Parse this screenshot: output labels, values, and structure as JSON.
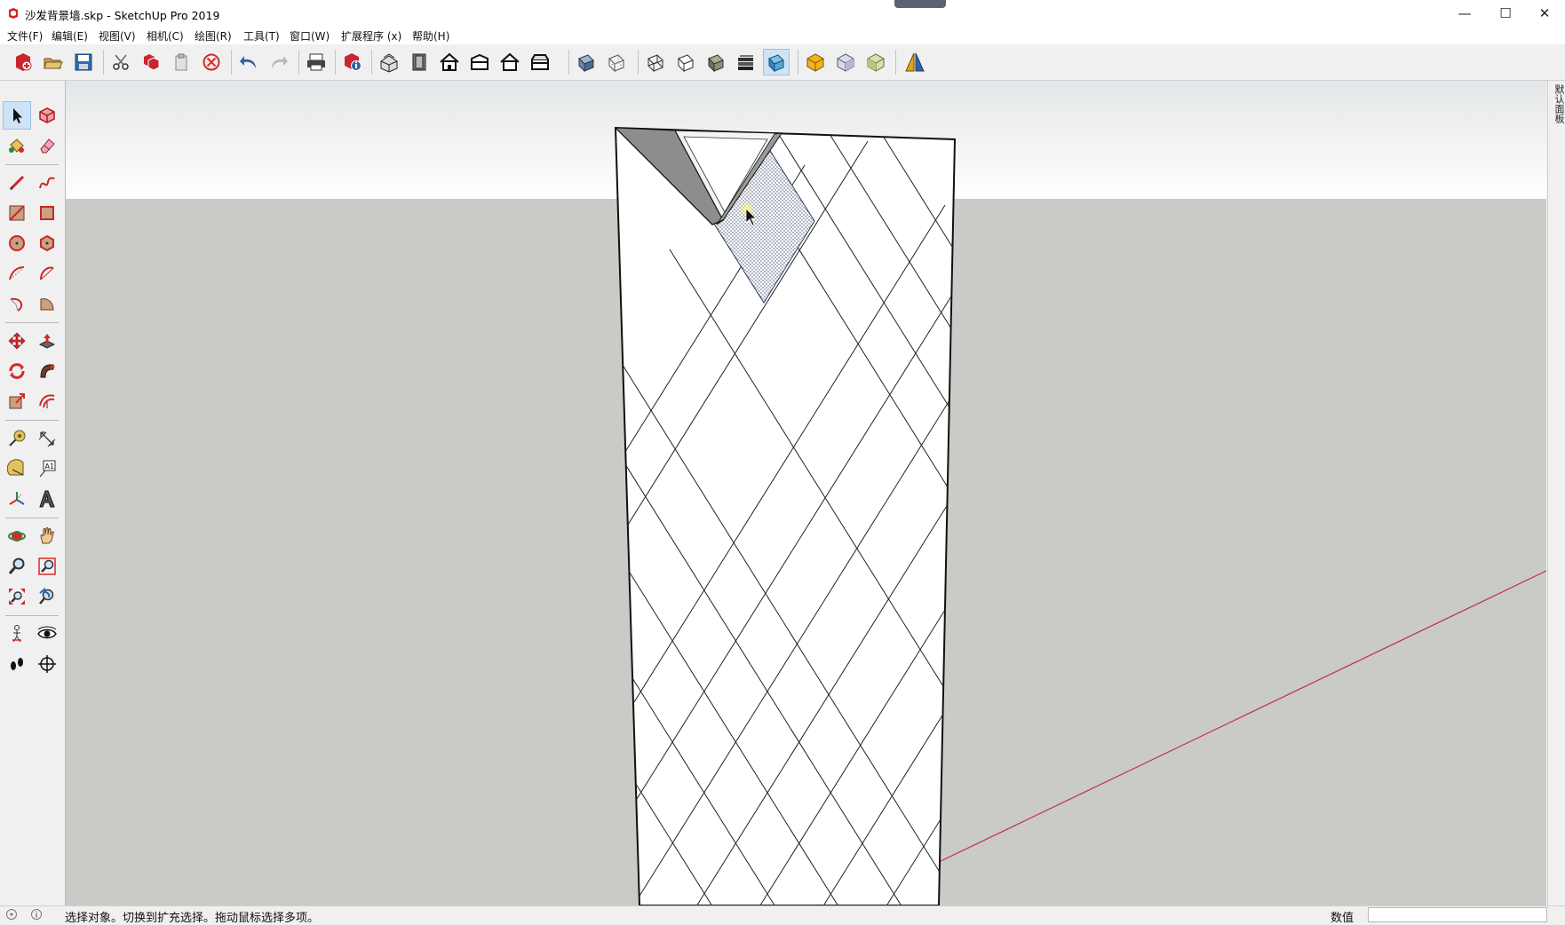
{
  "window": {
    "title": "沙发背景墙.skp - SketchUp Pro 2019",
    "minimize": "—",
    "maximize": "☐",
    "close": "✕"
  },
  "menu": {
    "items": [
      "文件(F)",
      "编辑(E)",
      "视图(V)",
      "相机(C)",
      "绘图(R)",
      "工具(T)",
      "窗口(W)",
      "扩展程序 (x)",
      "帮助(H)"
    ]
  },
  "toolbar": {
    "buttons": [
      "new-file-icon",
      "open-file-icon",
      "save-icon",
      "cut-icon",
      "copy-icon",
      "paste-icon",
      "erase-icon",
      "undo-icon",
      "redo-icon",
      "print-icon",
      "model-info-icon",
      "iso-view-icon",
      "top-view-icon",
      "front-view-icon",
      "right-view-icon",
      "back-view-icon",
      "left-view-icon",
      "xray-icon",
      "back-edges-icon",
      "wireframe-icon",
      "hidden-line-icon",
      "shaded-icon",
      "shaded-textures-icon",
      "monochrome-icon",
      "3d-warehouse-icon",
      "extension-warehouse-icon",
      "layout-icon",
      "section-plane-icon"
    ],
    "active": "shaded-textures-icon"
  },
  "left_toolbar": {
    "tools": [
      "select-icon",
      "make-component-icon",
      "paint-bucket-icon",
      "eraser-icon",
      "line-icon",
      "freehand-icon",
      "rectangle-icon",
      "rotated-rectangle-icon",
      "circle-icon",
      "polygon-icon",
      "arc-icon",
      "two-point-arc-icon",
      "three-point-arc-icon",
      "pie-icon",
      "move-icon",
      "push-pull-icon",
      "rotate-icon",
      "follow-me-icon",
      "scale-icon",
      "offset-icon",
      "tape-measure-icon",
      "dimension-icon",
      "protractor-icon",
      "text-icon",
      "axes-icon",
      "3d-text-icon",
      "orbit-icon",
      "pan-icon",
      "zoom-icon",
      "zoom-window-icon",
      "zoom-extents-icon",
      "previous-view-icon",
      "position-camera-icon",
      "look-around-icon",
      "walk-icon",
      "section-plane-tool-icon"
    ],
    "active": "select-icon"
  },
  "tray": {
    "label": "默认面板"
  },
  "colors": {
    "sky": "#ffffff",
    "ground": "#cacac7",
    "wall_face": "#ffffff",
    "edges": "#000000",
    "red_axis": "#c03040",
    "selection": "#3a4a6a"
  },
  "status": {
    "message": "选择对象。切换到扩充选择。拖动鼠标选择多项。",
    "measurements_label": "数值",
    "measurements_value": ""
  }
}
